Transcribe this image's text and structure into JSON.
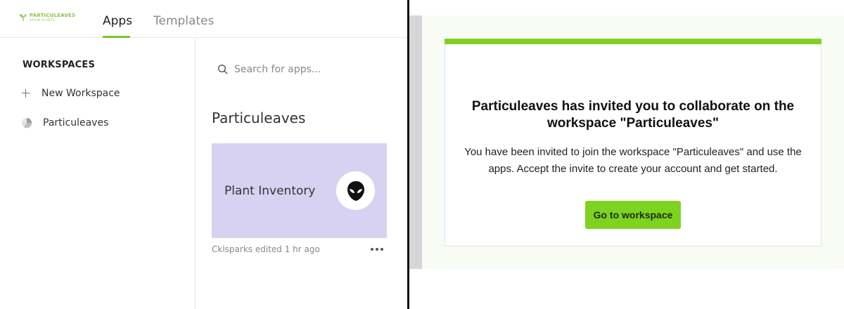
{
  "app": {
    "logo": {
      "name": "PARTICULEAVES",
      "tagline": "GROW PLANTS"
    },
    "tabs": [
      {
        "label": "Apps",
        "active": true
      },
      {
        "label": "Templates",
        "active": false
      }
    ],
    "sidebar": {
      "heading": "WORKSPACES",
      "new_workspace": "New Workspace",
      "workspaces": [
        "Particuleaves"
      ]
    },
    "search": {
      "placeholder": "Search for apps..."
    },
    "workspace_title": "Particuleaves",
    "app_card": {
      "name": "Plant Inventory",
      "icon": "alien-icon",
      "meta": "Cklsparks edited 1 hr ago",
      "background": "#d7d2f1"
    }
  },
  "email": {
    "title": "Particuleaves has invited you to collaborate on the workspace \"Particuleaves\"",
    "body": "You have been invited to join the workspace \"Particuleaves\" and use the apps. Accept the invite to create your account and get started.",
    "button": "Go to workspace",
    "accent": "#7ed321"
  },
  "colors": {
    "tab_underline": "#7cc62a",
    "brand_green": "#8bc34a"
  }
}
